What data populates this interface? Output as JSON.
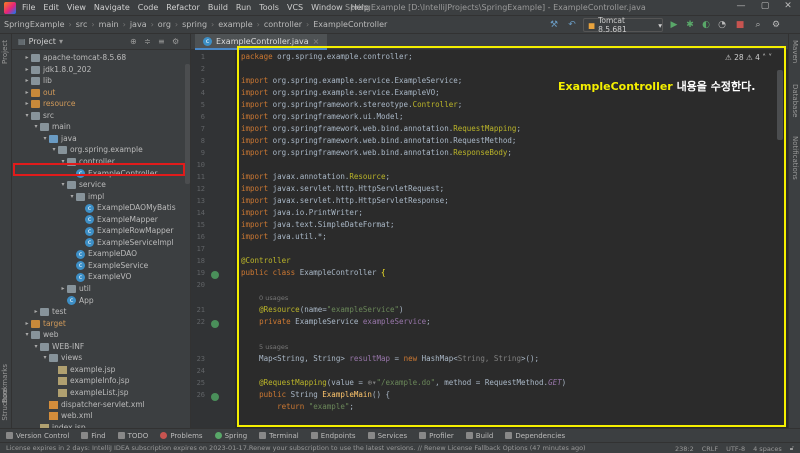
{
  "titlebar": {
    "menu": [
      "File",
      "Edit",
      "View",
      "Navigate",
      "Code",
      "Refactor",
      "Build",
      "Run",
      "Tools",
      "VCS",
      "Window",
      "Help"
    ],
    "window_title": "SpringExample [D:\\IntelliJProjects\\SpringExample] - ExampleController.java",
    "minimize": "—",
    "maximize": "▢",
    "close": "✕"
  },
  "navbar": {
    "breadcrumbs": [
      "SpringExample",
      "src",
      "main",
      "java",
      "org",
      "spring",
      "example",
      "controller",
      "ExampleController"
    ],
    "run_config": "Tomcat 8.5.681"
  },
  "leftstrip": {
    "labels": [
      "Project",
      "Bookmarks",
      "Structure"
    ]
  },
  "rightstrip": {
    "labels": [
      "Maven",
      "Database",
      "Notifications"
    ]
  },
  "project": {
    "header": "Project",
    "tree": [
      {
        "label": "apache-tomcat-8.5.68",
        "indent": 1,
        "icon": "folder",
        "arrow": "▸"
      },
      {
        "label": "jdk1.8.0_202",
        "indent": 1,
        "icon": "folder",
        "arrow": "▸"
      },
      {
        "label": "lib",
        "indent": 1,
        "icon": "folder",
        "arrow": "▸"
      },
      {
        "label": "out",
        "indent": 1,
        "icon": "folder-orange",
        "arrow": "▸"
      },
      {
        "label": "resource",
        "indent": 1,
        "icon": "folder-orange",
        "arrow": "▸"
      },
      {
        "label": "src",
        "indent": 1,
        "icon": "folder",
        "arrow": "▾"
      },
      {
        "label": "main",
        "indent": 2,
        "icon": "folder",
        "arrow": "▾"
      },
      {
        "label": "java",
        "indent": 3,
        "icon": "folder-blue",
        "arrow": "▾"
      },
      {
        "label": "org.spring.example",
        "indent": 4,
        "icon": "folder-pkg",
        "arrow": "▾"
      },
      {
        "label": "controller",
        "indent": 5,
        "icon": "folder-pkg",
        "arrow": "▾"
      },
      {
        "label": "ExampleController",
        "indent": 6,
        "icon": "class",
        "arrow": ""
      },
      {
        "label": "service",
        "indent": 5,
        "icon": "folder-pkg",
        "arrow": "▾"
      },
      {
        "label": "impl",
        "indent": 6,
        "icon": "folder-pkg",
        "arrow": "▾"
      },
      {
        "label": "ExampleDAOMyBatis",
        "indent": 7,
        "icon": "class",
        "arrow": ""
      },
      {
        "label": "ExampleMapper",
        "indent": 7,
        "icon": "class",
        "arrow": ""
      },
      {
        "label": "ExampleRowMapper",
        "indent": 7,
        "icon": "class",
        "arrow": ""
      },
      {
        "label": "ExampleServiceImpl",
        "indent": 7,
        "icon": "class",
        "arrow": ""
      },
      {
        "label": "ExampleDAO",
        "indent": 6,
        "icon": "class",
        "arrow": ""
      },
      {
        "label": "ExampleService",
        "indent": 6,
        "icon": "class",
        "arrow": ""
      },
      {
        "label": "ExampleVO",
        "indent": 6,
        "icon": "class",
        "arrow": ""
      },
      {
        "label": "util",
        "indent": 5,
        "icon": "folder-pkg",
        "arrow": "▸"
      },
      {
        "label": "App",
        "indent": 5,
        "icon": "class",
        "arrow": ""
      },
      {
        "label": "test",
        "indent": 2,
        "icon": "folder",
        "arrow": "▸"
      },
      {
        "label": "target",
        "indent": 1,
        "icon": "folder-orange",
        "arrow": "▸"
      },
      {
        "label": "web",
        "indent": 1,
        "icon": "folder",
        "arrow": "▾"
      },
      {
        "label": "WEB-INF",
        "indent": 2,
        "icon": "folder",
        "arrow": "▾"
      },
      {
        "label": "views",
        "indent": 3,
        "icon": "folder",
        "arrow": "▾"
      },
      {
        "label": "example.jsp",
        "indent": 4,
        "icon": "file",
        "arrow": ""
      },
      {
        "label": "exampleInfo.jsp",
        "indent": 4,
        "icon": "file",
        "arrow": ""
      },
      {
        "label": "exampleList.jsp",
        "indent": 4,
        "icon": "file",
        "arrow": ""
      },
      {
        "label": "dispatcher-servlet.xml",
        "indent": 3,
        "icon": "xml",
        "arrow": ""
      },
      {
        "label": "web.xml",
        "indent": 3,
        "icon": "xml",
        "arrow": ""
      },
      {
        "label": "index.jsp",
        "indent": 2,
        "icon": "file",
        "arrow": ""
      }
    ]
  },
  "editor": {
    "tab_label": "ExampleController.java",
    "warnings": "⚠ 28  ⚠ 4  ˄  ˅",
    "overlay_highlight": "ExampleController",
    "overlay_rest": " 내용을 수정한다.",
    "line_numbers": [
      "1",
      "2",
      "3",
      "4",
      "5",
      "6",
      "7",
      "8",
      "9",
      "10",
      "11",
      "12",
      "13",
      "14",
      "15",
      "16",
      "17",
      "18",
      "19",
      "20",
      "",
      "21",
      "22",
      "",
      "23",
      "24",
      "",
      "25",
      "26"
    ]
  },
  "bottom_tools": [
    "Version Control",
    "Find",
    "TODO",
    "Problems",
    "Spring",
    "Terminal",
    "Endpoints",
    "Services",
    "Profiler",
    "Build",
    "Dependencies"
  ],
  "status": {
    "message": "License expires in 2 days: IntelliJ IDEA subscription expires on 2023-01-17.Renew your subscription to use the latest versions. // Renew License    Fallback Options (47 minutes ago)",
    "position": "238:2",
    "line_sep": "CRLF",
    "encoding": "UTF-8",
    "indent": "4 spaces"
  }
}
